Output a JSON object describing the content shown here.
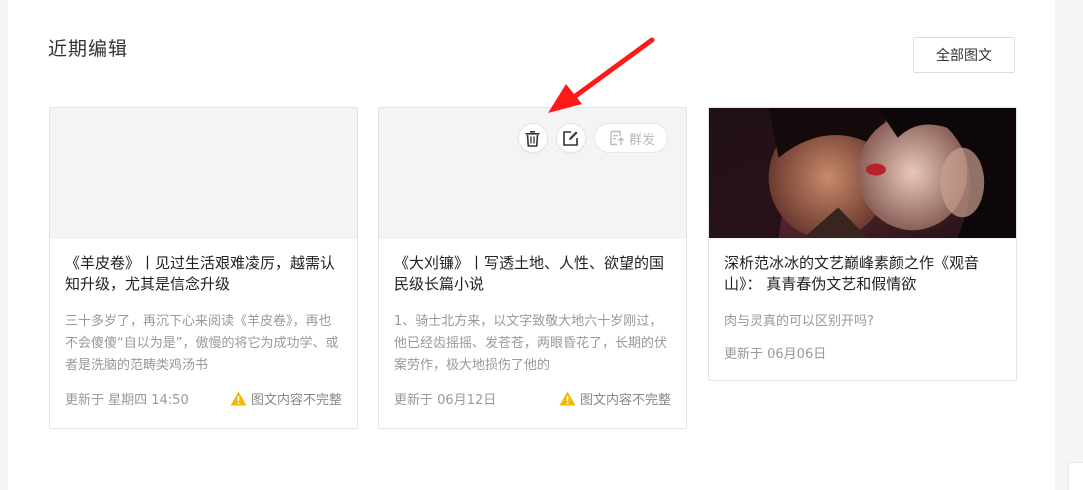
{
  "section": {
    "title": "近期编辑",
    "all_button": "全部图文"
  },
  "cards": [
    {
      "title": "《羊皮卷》丨见过生活艰难凌厉，越需认知升级，尤其是信念升级",
      "summary": "三十多岁了，再沉下心来阅读《羊皮卷》，再也不会傻傻“自以为是”，傲慢的将它为成功学、或者是洗脑的范畴类鸡汤书",
      "updated": "更新于 星期四 14:50",
      "warning": "图文内容不完整"
    },
    {
      "title": "《大刈镰》丨写透土地、人性、欲望的国民级长篇小说",
      "summary": "1、骑士北方来，以文字致敬大地六十岁刚过，他已经齿摇摇、发苍苍，两眼昏花了，长期的伏案劳作，极大地损伤了他的",
      "updated": "更新于 06月12日",
      "warning": "图文内容不完整",
      "tools": {
        "mass_send_label": "群发"
      }
    },
    {
      "title": "深析范冰冰的文艺巅峰素颜之作《观音山》： 真青春伪文艺和假情欲",
      "summary": "肉与灵真的可以区别开吗?",
      "updated": "更新于 06月06日"
    }
  ],
  "colors": {
    "warning": "#f5b800",
    "arrow": "#ff1a1a"
  }
}
